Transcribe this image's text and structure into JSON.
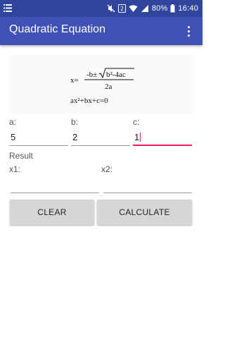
{
  "status_bar": {
    "battery_percent": "80%",
    "time": "16:40"
  },
  "app_bar": {
    "title": "Quadratic Equation",
    "menu_icon": "more-vert-icon"
  },
  "formula": {
    "lhs": "x=",
    "numerator_prefix": "-b±",
    "radicand": "b²-4ac",
    "denominator": "2a",
    "equation": "ax²+bx+c=0"
  },
  "inputs": {
    "a": {
      "label": "a:",
      "value": "5"
    },
    "b": {
      "label": "b:",
      "value": "2"
    },
    "c": {
      "label": "c:",
      "value": "1"
    }
  },
  "result": {
    "heading": "Result",
    "x1_label": "x1:",
    "x2_label": "x2:",
    "x1_value": "",
    "x2_value": ""
  },
  "buttons": {
    "clear": "CLEAR",
    "calculate": "CALCULATE"
  },
  "colors": {
    "status_bar": "#30469c",
    "app_bar": "#3f51b5",
    "accent": "#e91e63",
    "button": "#d6d6d6"
  }
}
